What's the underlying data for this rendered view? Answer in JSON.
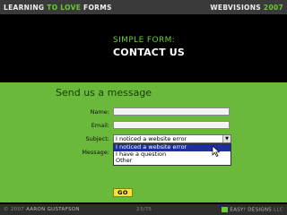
{
  "top_bar": {
    "deck_title_pre": "LEARNING ",
    "deck_title_highlight": "TO LOVE",
    "deck_title_post": " FORMS",
    "conference_name": "WEBVISIONS",
    "conference_year": "2007"
  },
  "slide": {
    "kicker": "SIMPLE FORM:",
    "heading": "CONTACT US"
  },
  "form": {
    "title": "Send us a message",
    "name_label": "Name:",
    "email_label": "Email:",
    "subject_label": "Subject:",
    "message_label": "Message:",
    "subject_selected": "I noticed a website error",
    "subject_options": [
      "I noticed a website error",
      "I have a question",
      "Other"
    ],
    "submit_label": "GO"
  },
  "bottom_bar": {
    "copyright_symbol_year": "© 2007",
    "author": "AARON GUSTAFSON",
    "slide_counter": "23/75",
    "credit_company": "EASY! DESIGNS",
    "credit_suffix": "LLC"
  },
  "colors": {
    "accent_green": "#66cc33",
    "panel_green": "#6ab93a",
    "button_yellow": "#f5e23a",
    "selection_blue": "#1d2f9a"
  }
}
